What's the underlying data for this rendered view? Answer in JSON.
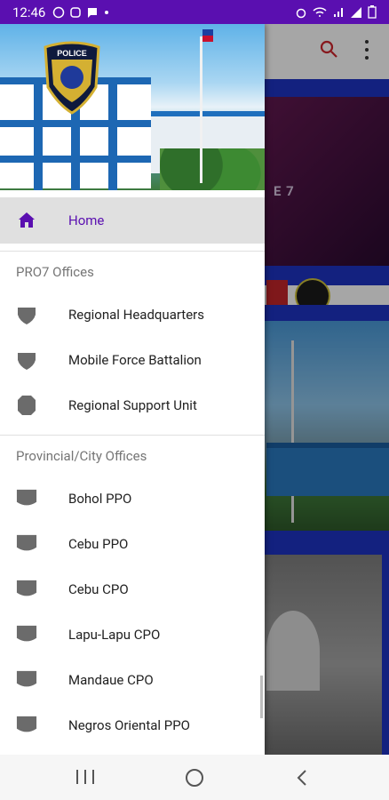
{
  "status_bar": {
    "time": "12:46",
    "left_icons": [
      "whatsapp-icon",
      "viber-icon",
      "message-icon",
      "dot-icon"
    ],
    "right_icons": [
      "alarm-icon",
      "wifi-icon",
      "lte-signal-icon",
      "signal-icon",
      "battery-icon"
    ],
    "background": "#5a0fb0"
  },
  "app_bar": {
    "search_icon": "search-icon",
    "overflow_icon": "more-vert-icon"
  },
  "background_content": {
    "banner1_text": "E 7"
  },
  "drawer": {
    "header_logo_text": "POLICE",
    "home": {
      "label": "Home",
      "icon": "home-icon",
      "color": "#5a0fb0"
    },
    "sections": [
      {
        "title": "PRO7 Offices",
        "items": [
          {
            "label": "Regional Headquarters",
            "icon": "shield-icon"
          },
          {
            "label": "Mobile Force Battalion",
            "icon": "shield-icon"
          },
          {
            "label": "Regional Support Unit",
            "icon": "badge-icon"
          }
        ]
      },
      {
        "title": "Provincial/City Offices",
        "items": [
          {
            "label": "Bohol PPO",
            "icon": "shield-flat-icon"
          },
          {
            "label": "Cebu PPO",
            "icon": "shield-flat-icon"
          },
          {
            "label": "Cebu CPO",
            "icon": "shield-flat-icon"
          },
          {
            "label": "Lapu-Lapu CPO",
            "icon": "shield-flat-icon"
          },
          {
            "label": "Mandaue CPO",
            "icon": "shield-flat-icon"
          },
          {
            "label": "Negros Oriental PPO",
            "icon": "shield-flat-icon"
          }
        ]
      }
    ]
  },
  "nav_bar": {
    "buttons": [
      "recent-apps-button",
      "home-button",
      "back-button"
    ]
  }
}
